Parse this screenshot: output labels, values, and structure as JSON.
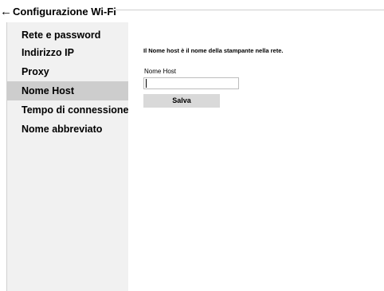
{
  "header": {
    "back_icon": "←",
    "title": "Configurazione Wi-Fi"
  },
  "sidebar": {
    "items": [
      {
        "label": "Rete e password",
        "selected": false
      },
      {
        "label": "Indirizzo IP",
        "selected": false
      },
      {
        "label": "Proxy",
        "selected": false
      },
      {
        "label": "Nome Host",
        "selected": true
      },
      {
        "label": "Tempo di connessione dir",
        "selected": false
      },
      {
        "label": "Nome abbreviato",
        "selected": false
      }
    ]
  },
  "main": {
    "description": "Il Nome host è il nome della stampante nella rete.",
    "host_field": {
      "label": "Nome Host",
      "value": "",
      "placeholder": ""
    },
    "save_label": "Salva"
  },
  "colors": {
    "sidebar_bg": "#f1f1f1",
    "selected_bg": "#cdcdcd",
    "button_bg": "#d9d9d9"
  }
}
